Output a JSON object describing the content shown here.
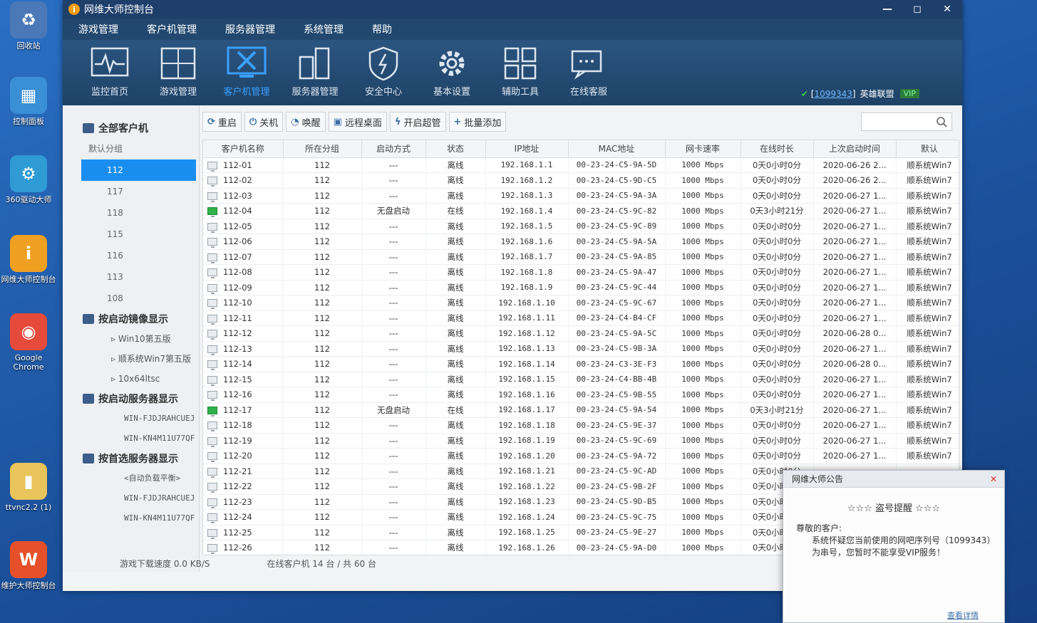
{
  "desktop": {
    "icons": [
      {
        "label": "回收站",
        "glyph": "♻",
        "color": "#4b79b8"
      },
      {
        "label": "控制面板",
        "glyph": "▦",
        "color": "#3a8fd6"
      },
      {
        "label": "360驱动大师",
        "glyph": "⚙",
        "color": "#2e9bd4"
      },
      {
        "label": "网维大师控制台",
        "glyph": "i",
        "color": "#f0a020"
      },
      {
        "label": "Google Chrome",
        "glyph": "◉",
        "color": "#e64a3b"
      },
      {
        "label": "ttvnc2.2 (1)",
        "glyph": "▮",
        "color": "#e8c45a"
      },
      {
        "label": "维护大师控制台",
        "glyph": "W",
        "color": "#e5502a"
      }
    ]
  },
  "window": {
    "title": "网维大师控制台",
    "controls": {
      "minimize": "—",
      "maximize": "◻",
      "close": "✕"
    },
    "menu": [
      "游戏管理",
      "客户机管理",
      "服务器管理",
      "系统管理",
      "帮助"
    ],
    "toolbar": [
      {
        "label": "监控首页",
        "icon": "monitor-pulse-icon"
      },
      {
        "label": "游戏管理",
        "icon": "game-grid-icon"
      },
      {
        "label": "客户机管理",
        "icon": "client-tools-icon",
        "active": true
      },
      {
        "label": "服务器管理",
        "icon": "server-icon"
      },
      {
        "label": "安全中心",
        "icon": "shield-icon"
      },
      {
        "label": "基本设置",
        "icon": "gear-icon"
      },
      {
        "label": "辅助工具",
        "icon": "tiles-icon"
      },
      {
        "label": "在线客服",
        "icon": "chat-icon"
      }
    ],
    "account": {
      "check": "✔",
      "id_prefix": "[",
      "id": "1099343",
      "id_suffix": "]",
      "name": "英雄联盟",
      "vip": "VIP"
    }
  },
  "leftpanel": {
    "all_clients": "全部客户机",
    "groups": [
      "默认分组",
      "112",
      "117",
      "118",
      "115",
      "116",
      "113",
      "108"
    ],
    "selected_group": "112",
    "by_image": "按启动镜像显示",
    "images": [
      "Win10第五版",
      "顺系统Win7第五版",
      "10x64ltsc"
    ],
    "by_server": "按启动服务器显示",
    "servers": [
      "WIN-FJDJRAHCUEJ",
      "WIN-KN4M11U77QF"
    ],
    "by_pref_server": "按首选服务器显示",
    "pref_servers": [
      "<自动负载平衡>",
      "WIN-FJDJRAHCUEJ",
      "WIN-KN4M11U77QF"
    ]
  },
  "actions": [
    {
      "label": "重启",
      "glyph": "⟳"
    },
    {
      "label": "关机",
      "glyph": "⏻"
    },
    {
      "label": "唤醒",
      "glyph": "◔"
    },
    {
      "label": "远程桌面",
      "glyph": "▣"
    },
    {
      "label": "开启超管",
      "glyph": "ϟ"
    },
    {
      "label": "批量添加",
      "glyph": "+"
    }
  ],
  "table": {
    "columns": [
      "客户机名称",
      "所在分组",
      "启动方式",
      "状态",
      "IP地址",
      "MAC地址",
      "网卡速率",
      "在线时长",
      "上次启动时间",
      "默认"
    ],
    "rows": [
      {
        "name": "112-01",
        "group": "112",
        "boot": "---",
        "status": "离线",
        "ip": "192.168.1.1",
        "mac": "00-23-24-C5-9A-5D",
        "speed": "1000 Mbps",
        "online": "0天0小时0分",
        "last": "2020-06-26 2...",
        "image": "顺系统Win7",
        "on": false
      },
      {
        "name": "112-02",
        "group": "112",
        "boot": "---",
        "status": "离线",
        "ip": "192.168.1.2",
        "mac": "00-23-24-C5-9D-C5",
        "speed": "1000 Mbps",
        "online": "0天0小时0分",
        "last": "2020-06-26 2...",
        "image": "顺系统Win7",
        "on": false
      },
      {
        "name": "112-03",
        "group": "112",
        "boot": "---",
        "status": "离线",
        "ip": "192.168.1.3",
        "mac": "00-23-24-C5-9A-3A",
        "speed": "1000 Mbps",
        "online": "0天0小时0分",
        "last": "2020-06-27 1...",
        "image": "顺系统Win7",
        "on": false
      },
      {
        "name": "112-04",
        "group": "112",
        "boot": "无盘启动",
        "status": "在线",
        "ip": "192.168.1.4",
        "mac": "00-23-24-C5-9C-82",
        "speed": "1000 Mbps",
        "online": "0天3小时21分",
        "last": "2020-06-27 1...",
        "image": "顺系统Win7",
        "on": true
      },
      {
        "name": "112-05",
        "group": "112",
        "boot": "---",
        "status": "离线",
        "ip": "192.168.1.5",
        "mac": "00-23-24-C5-9C-89",
        "speed": "1000 Mbps",
        "online": "0天0小时0分",
        "last": "2020-06-27 1...",
        "image": "顺系统Win7",
        "on": false
      },
      {
        "name": "112-06",
        "group": "112",
        "boot": "---",
        "status": "离线",
        "ip": "192.168.1.6",
        "mac": "00-23-24-C5-9A-5A",
        "speed": "1000 Mbps",
        "online": "0天0小时0分",
        "last": "2020-06-27 1...",
        "image": "顺系统Win7",
        "on": false
      },
      {
        "name": "112-07",
        "group": "112",
        "boot": "---",
        "status": "离线",
        "ip": "192.168.1.7",
        "mac": "00-23-24-C5-9A-85",
        "speed": "1000 Mbps",
        "online": "0天0小时0分",
        "last": "2020-06-27 1...",
        "image": "顺系统Win7",
        "on": false
      },
      {
        "name": "112-08",
        "group": "112",
        "boot": "---",
        "status": "离线",
        "ip": "192.168.1.8",
        "mac": "00-23-24-C5-9A-47",
        "speed": "1000 Mbps",
        "online": "0天0小时0分",
        "last": "2020-06-27 1...",
        "image": "顺系统Win7",
        "on": false
      },
      {
        "name": "112-09",
        "group": "112",
        "boot": "---",
        "status": "离线",
        "ip": "192.168.1.9",
        "mac": "00-23-24-C5-9C-44",
        "speed": "1000 Mbps",
        "online": "0天0小时0分",
        "last": "2020-06-27 1...",
        "image": "顺系统Win7",
        "on": false
      },
      {
        "name": "112-10",
        "group": "112",
        "boot": "---",
        "status": "离线",
        "ip": "192.168.1.10",
        "mac": "00-23-24-C5-9C-67",
        "speed": "1000 Mbps",
        "online": "0天0小时0分",
        "last": "2020-06-27 1...",
        "image": "顺系统Win7",
        "on": false
      },
      {
        "name": "112-11",
        "group": "112",
        "boot": "---",
        "status": "离线",
        "ip": "192.168.1.11",
        "mac": "00-23-24-C4-B4-CF",
        "speed": "1000 Mbps",
        "online": "0天0小时0分",
        "last": "2020-06-27 1...",
        "image": "顺系统Win7",
        "on": false
      },
      {
        "name": "112-12",
        "group": "112",
        "boot": "---",
        "status": "离线",
        "ip": "192.168.1.12",
        "mac": "00-23-24-C5-9A-5C",
        "speed": "1000 Mbps",
        "online": "0天0小时0分",
        "last": "2020-06-28 0...",
        "image": "顺系统Win7",
        "on": false
      },
      {
        "name": "112-13",
        "group": "112",
        "boot": "---",
        "status": "离线",
        "ip": "192.168.1.13",
        "mac": "00-23-24-C5-9B-3A",
        "speed": "1000 Mbps",
        "online": "0天0小时0分",
        "last": "2020-06-27 1...",
        "image": "顺系统Win7",
        "on": false
      },
      {
        "name": "112-14",
        "group": "112",
        "boot": "---",
        "status": "离线",
        "ip": "192.168.1.14",
        "mac": "00-23-24-C3-3E-F3",
        "speed": "1000 Mbps",
        "online": "0天0小时0分",
        "last": "2020-06-28 0...",
        "image": "顺系统Win7",
        "on": false
      },
      {
        "name": "112-15",
        "group": "112",
        "boot": "---",
        "status": "离线",
        "ip": "192.168.1.15",
        "mac": "00-23-24-C4-BB-4B",
        "speed": "1000 Mbps",
        "online": "0天0小时0分",
        "last": "2020-06-27 1...",
        "image": "顺系统Win7",
        "on": false
      },
      {
        "name": "112-16",
        "group": "112",
        "boot": "---",
        "status": "离线",
        "ip": "192.168.1.16",
        "mac": "00-23-24-C5-9B-55",
        "speed": "1000 Mbps",
        "online": "0天0小时0分",
        "last": "2020-06-27 1...",
        "image": "顺系统Win7",
        "on": false
      },
      {
        "name": "112-17",
        "group": "112",
        "boot": "无盘启动",
        "status": "在线",
        "ip": "192.168.1.17",
        "mac": "00-23-24-C5-9A-54",
        "speed": "1000 Mbps",
        "online": "0天3小时21分",
        "last": "2020-06-27 1...",
        "image": "顺系统Win7",
        "on": true
      },
      {
        "name": "112-18",
        "group": "112",
        "boot": "---",
        "status": "离线",
        "ip": "192.168.1.18",
        "mac": "00-23-24-C5-9E-37",
        "speed": "1000 Mbps",
        "online": "0天0小时0分",
        "last": "2020-06-27 1...",
        "image": "顺系统Win7",
        "on": false
      },
      {
        "name": "112-19",
        "group": "112",
        "boot": "---",
        "status": "离线",
        "ip": "192.168.1.19",
        "mac": "00-23-24-C5-9C-69",
        "speed": "1000 Mbps",
        "online": "0天0小时0分",
        "last": "2020-06-27 1...",
        "image": "顺系统Win7",
        "on": false
      },
      {
        "name": "112-20",
        "group": "112",
        "boot": "---",
        "status": "离线",
        "ip": "192.168.1.20",
        "mac": "00-23-24-C5-9A-72",
        "speed": "1000 Mbps",
        "online": "0天0小时0分",
        "last": "2020-06-27 1...",
        "image": "顺系统Win7",
        "on": false
      },
      {
        "name": "112-21",
        "group": "112",
        "boot": "---",
        "status": "离线",
        "ip": "192.168.1.21",
        "mac": "00-23-24-C5-9C-AD",
        "speed": "1000 Mbps",
        "online": "0天0小时0分",
        "last": "",
        "image": "",
        "on": false
      },
      {
        "name": "112-22",
        "group": "112",
        "boot": "---",
        "status": "离线",
        "ip": "192.168.1.22",
        "mac": "00-23-24-C5-9B-2F",
        "speed": "1000 Mbps",
        "online": "0天0小时0分",
        "last": "",
        "image": "",
        "on": false
      },
      {
        "name": "112-23",
        "group": "112",
        "boot": "---",
        "status": "离线",
        "ip": "192.168.1.23",
        "mac": "00-23-24-C5-9D-B5",
        "speed": "1000 Mbps",
        "online": "0天0小时0分",
        "last": "",
        "image": "",
        "on": false
      },
      {
        "name": "112-24",
        "group": "112",
        "boot": "---",
        "status": "离线",
        "ip": "192.168.1.24",
        "mac": "00-23-24-C5-9C-75",
        "speed": "1000 Mbps",
        "online": "0天0小时0分",
        "last": "",
        "image": "",
        "on": false
      },
      {
        "name": "112-25",
        "group": "112",
        "boot": "---",
        "status": "离线",
        "ip": "192.168.1.25",
        "mac": "00-23-24-C5-9E-27",
        "speed": "1000 Mbps",
        "online": "0天0小时0分",
        "last": "",
        "image": "",
        "on": false
      },
      {
        "name": "112-26",
        "group": "112",
        "boot": "---",
        "status": "离线",
        "ip": "192.168.1.26",
        "mac": "00-23-24-C5-9A-D0",
        "speed": "1000 Mbps",
        "online": "0天0小时0分",
        "last": "",
        "image": "",
        "on": false
      }
    ]
  },
  "status": {
    "download": "游戏下载速度 0.0 KB/S",
    "online": "在线客户机 14 台 / 共 60 台"
  },
  "popup": {
    "title": "网维大师公告",
    "close": "✕",
    "heading": "☆☆☆ 盗号提醒 ☆☆☆",
    "greeting": "尊敬的客户:",
    "message": "系统怀疑您当前使用的网吧序列号（1099343）为串号，您暂时不能享受VIP服务！",
    "more": "查看详情"
  },
  "colors": {
    "accent": "#1a8ef0",
    "titlebar": "#1f3f6b",
    "online_icon": "#2fb14a"
  }
}
